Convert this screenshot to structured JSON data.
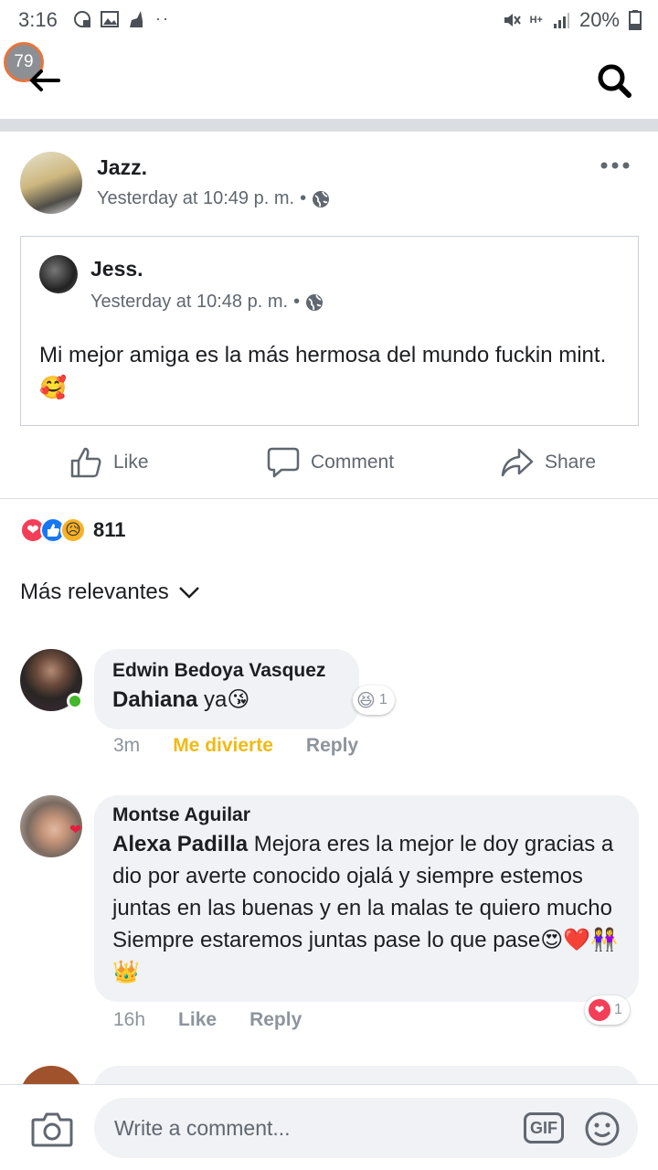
{
  "status_bar": {
    "time": "3:16",
    "battery": "20%",
    "network": "H+"
  },
  "header": {
    "notification_count": "79"
  },
  "post": {
    "author": "Jazz.",
    "timestamp": "Yesterday at 10:49 p. m.",
    "separator": "•",
    "shared": {
      "author": "Jess.",
      "timestamp": "Yesterday at 10:48 p. m.",
      "separator": "•",
      "text": "Mi mejor amiga es la más hermosa del mundo fuckin mint. 🥰"
    },
    "actions": {
      "like": "Like",
      "comment": "Comment",
      "share": "Share"
    },
    "reaction_count": "811"
  },
  "comments_sort": "Más relevantes",
  "comments": [
    {
      "author": "Edwin Bedoya Vasquez",
      "tag": "Dahiana",
      "text": " ya😘",
      "time": "3m",
      "reaction_label": "Me divierte",
      "reply": "Reply",
      "reaction_badge": "😆",
      "reaction_badge_count": "1"
    },
    {
      "author": "Montse Aguilar",
      "tag": "Alexa Padilla",
      "text": " Mejora eres la mejor le doy gracias a dio por averte conocido ojalá y siempre estemos juntas en las buenas y en la malas te quiero mucho Siempre estaremos juntas pase lo que pase😍❤️👭👑",
      "time": "16h",
      "like": "Like",
      "reply": "Reply",
      "reaction_badge": "❤",
      "reaction_badge_count": "1"
    }
  ],
  "composer": {
    "placeholder": "Write a comment...",
    "gif": "GIF"
  },
  "colors": {
    "divider": "#dadde1",
    "bubble": "#f0f2f5",
    "me_divierte": "#f0ba15",
    "online": "#42b72a",
    "badge_ring": "#e8743b"
  }
}
